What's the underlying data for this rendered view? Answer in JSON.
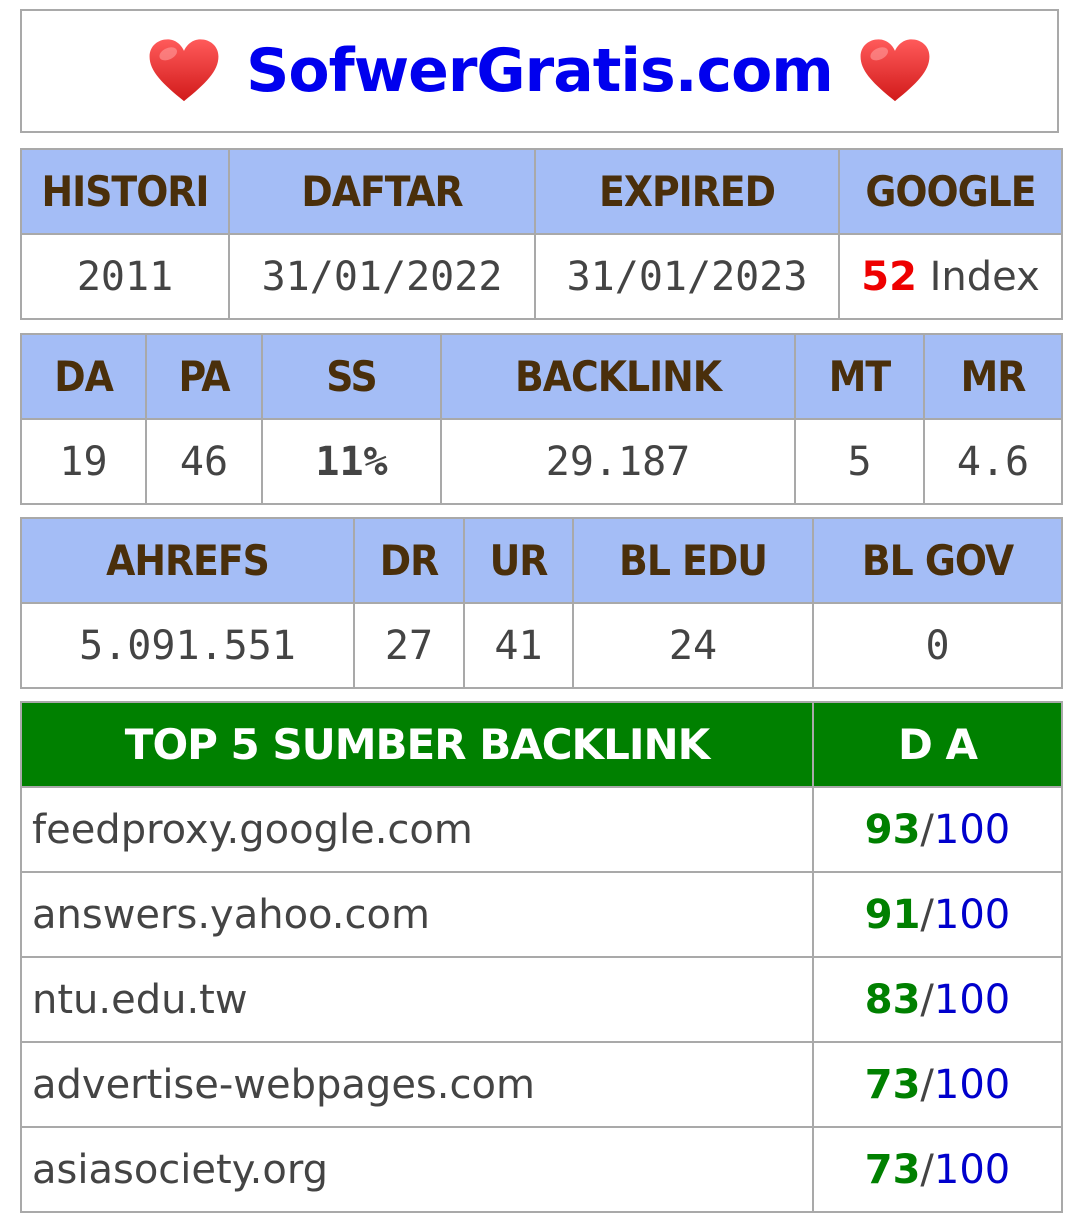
{
  "header": {
    "site_name": "SofwerGratis.com",
    "left_icon": "heart-icon",
    "right_icon": "heart-icon"
  },
  "domain_info": {
    "headers": [
      "HISTORI",
      "DAFTAR",
      "EXPIRED",
      "GOOGLE"
    ],
    "histori": "2011",
    "daftar": "31/01/2022",
    "expired": "31/01/2023",
    "google_count": "52",
    "google_label": "Index"
  },
  "moz": {
    "headers": [
      "DA",
      "PA",
      "SS",
      "BACKLINK",
      "MT",
      "MR"
    ],
    "values": [
      "19",
      "46",
      "11%",
      "29.187",
      "5",
      "4.6"
    ]
  },
  "ahrefs": {
    "headers": [
      "AHREFS",
      "DR",
      "UR",
      "BL EDU",
      "BL GOV"
    ],
    "values": [
      "5.091.551",
      "27",
      "41",
      "24",
      "0"
    ]
  },
  "top_backlinks": {
    "headers": [
      "TOP 5 SUMBER BACKLINK",
      "D A"
    ],
    "rows": [
      {
        "domain": "feedproxy.google.com",
        "da": "93",
        "max": "100"
      },
      {
        "domain": "answers.yahoo.com",
        "da": "91",
        "max": "100"
      },
      {
        "domain": "ntu.edu.tw",
        "da": "83",
        "max": "100"
      },
      {
        "domain": "advertise-webpages.com",
        "da": "73",
        "max": "100"
      },
      {
        "domain": "asiasociety.org",
        "da": "73",
        "max": "100"
      }
    ],
    "separator": "/"
  },
  "colors": {
    "header_bg": "#a4bdf6",
    "header_text": "#4a2f0b",
    "green_header": "#008000",
    "title": "#0000ee",
    "google_count": "#ee0000",
    "ss_value": "#1ec8c8"
  }
}
